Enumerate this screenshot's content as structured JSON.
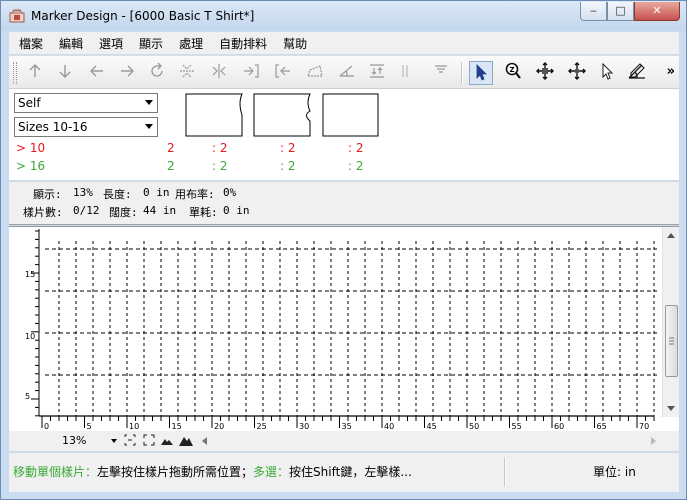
{
  "window": {
    "title": "Marker Design - [6000 Basic T Shirt*]",
    "minimize_glyph": "‒",
    "maximize_glyph": "□",
    "close_glyph": "✕"
  },
  "menu": {
    "items": [
      "檔案",
      "編輯",
      "選項",
      "顯示",
      "處理",
      "自動排料",
      "幫助"
    ]
  },
  "toolbar": {
    "icons": [
      "move-up-icon",
      "move-down-icon",
      "move-left-icon",
      "move-right-icon",
      "rotate-icon",
      "flip-vertical-icon",
      "flip-horizontal-icon",
      "push-right-icon",
      "push-left-icon",
      "fold-icon",
      "angle-icon",
      "align-icon",
      "split-icon",
      "menu-icon",
      "select-arrow-icon",
      "zoom-icon",
      "move-cross-icon",
      "move-piece-icon",
      "pointer-icon",
      "measure-icon"
    ],
    "more_glyph": "»"
  },
  "pieces": {
    "layer_select": "Self",
    "size_select": "Sizes 10-16"
  },
  "sizes": [
    {
      "label": "> 10",
      "count": "2",
      "p1": ": 2",
      "p2": ": 2",
      "p3": ": 2",
      "color": "#e8191c"
    },
    {
      "label": "> 16",
      "count": "2",
      "p1": ": 2",
      "p2": ": 2",
      "p3": ": 2",
      "color": "#3aaa35"
    }
  ],
  "info": {
    "display_label": "顯示:",
    "display_value": "13%",
    "length_label": "長度:",
    "length_value": "0 in",
    "usage_label": "用布率:",
    "usage_value": "0%",
    "pieces_label": "樣片數:",
    "pieces_value": "0/12",
    "width_label": "闊度:",
    "width_value": "44 in",
    "consumption_label": "單耗:",
    "consumption_value": "0 in"
  },
  "ruler": {
    "x_labels": [
      "0",
      "5",
      "10",
      "15",
      "20",
      "25",
      "30",
      "35",
      "40",
      "45",
      "50",
      "55",
      "60",
      "65",
      "70"
    ],
    "y_labels": [
      "15",
      "10",
      "5"
    ]
  },
  "bottom": {
    "zoom_value": "13%"
  },
  "status": {
    "message_green_1": "移動單個樣片：",
    "message_black_1": "左擊按住樣片拖動所需位置；",
    "message_green_2": "多選：",
    "message_black_2": "按住Shift鍵，左擊樣...",
    "unit": "單位: in"
  }
}
